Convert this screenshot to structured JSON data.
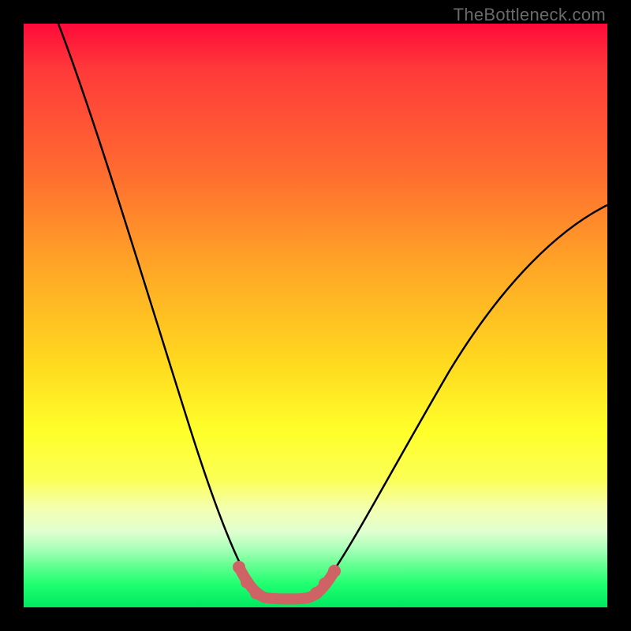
{
  "watermark": "TheBottleneck.com",
  "colors": {
    "background": "#000000",
    "curve": "#000000",
    "good_region": "#cf6265",
    "good_region_dot": "#cf6265"
  },
  "chart_data": {
    "type": "line",
    "title": "",
    "xlabel": "",
    "ylabel": "",
    "xlim": [
      0,
      100
    ],
    "ylim": [
      0,
      100
    ],
    "grid": false,
    "series": [
      {
        "name": "bottleneck-curve",
        "x": [
          5,
          10,
          15,
          20,
          25,
          30,
          33,
          36,
          38,
          40,
          42,
          45,
          48,
          52,
          58,
          65,
          72,
          80,
          88,
          95,
          100
        ],
        "values": [
          100,
          87,
          74,
          61,
          48,
          33,
          22,
          12,
          6,
          2,
          1,
          1,
          2,
          6,
          15,
          27,
          38,
          48,
          56,
          62,
          66
        ]
      }
    ],
    "annotations": [
      {
        "name": "optimal-band",
        "x_range": [
          36,
          52
        ],
        "y_approx": 1
      }
    ]
  }
}
